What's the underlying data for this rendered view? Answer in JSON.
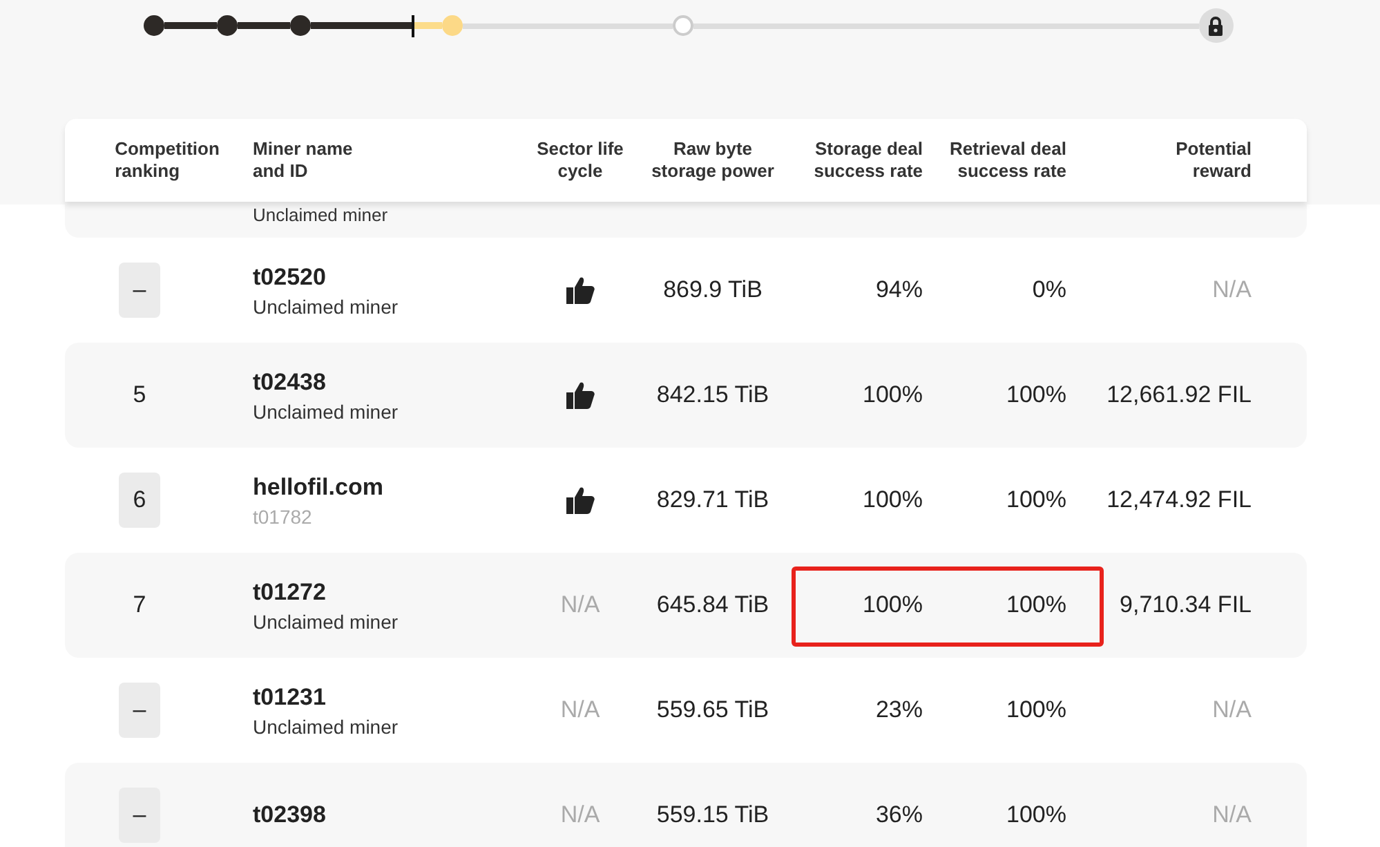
{
  "progress": {
    "steps": [
      {
        "kind": "done"
      },
      {
        "kind": "done"
      },
      {
        "kind": "done"
      },
      {
        "kind": "current"
      },
      {
        "kind": "upcoming"
      },
      {
        "kind": "locked"
      }
    ]
  },
  "table": {
    "columns": [
      "Competition ranking",
      "Miner name and ID",
      "Sector life cycle",
      "Raw byte storage power",
      "Storage deal success rate",
      "Retrieval deal success rate",
      "Potential reward"
    ],
    "cut_row": {
      "subtitle": "Unclaimed miner"
    },
    "rows": [
      {
        "rank": "–",
        "rank_badge": true,
        "name": "t02520",
        "subtitle": "Unclaimed miner",
        "subtitle_muted": false,
        "sector": {
          "kind": "thumb"
        },
        "power": "869.9 TiB",
        "storage_rate": "94%",
        "retrieval_rate": "0%",
        "reward": "N/A",
        "reward_muted": true,
        "highlighted": false
      },
      {
        "rank": "5",
        "rank_badge": false,
        "name": "t02438",
        "subtitle": "Unclaimed miner",
        "subtitle_muted": false,
        "sector": {
          "kind": "thumb"
        },
        "power": "842.15 TiB",
        "storage_rate": "100%",
        "retrieval_rate": "100%",
        "reward": "12,661.92 FIL",
        "reward_muted": false,
        "highlighted": false
      },
      {
        "rank": "6",
        "rank_badge": true,
        "name": "hellofil.com",
        "subtitle": "t01782",
        "subtitle_muted": true,
        "sector": {
          "kind": "thumb"
        },
        "power": "829.71 TiB",
        "storage_rate": "100%",
        "retrieval_rate": "100%",
        "reward": "12,474.92 FIL",
        "reward_muted": false,
        "highlighted": false
      },
      {
        "rank": "7",
        "rank_badge": false,
        "name": "t01272",
        "subtitle": "Unclaimed miner",
        "subtitle_muted": false,
        "sector": {
          "kind": "text",
          "text": "N/A"
        },
        "power": "645.84 TiB",
        "storage_rate": "100%",
        "retrieval_rate": "100%",
        "reward": "9,710.34 FIL",
        "reward_muted": false,
        "highlighted": true
      },
      {
        "rank": "–",
        "rank_badge": true,
        "name": "t01231",
        "subtitle": "Unclaimed miner",
        "subtitle_muted": false,
        "sector": {
          "kind": "text",
          "text": "N/A"
        },
        "power": "559.65 TiB",
        "storage_rate": "23%",
        "retrieval_rate": "100%",
        "reward": "N/A",
        "reward_muted": true,
        "highlighted": false
      },
      {
        "rank": "–",
        "rank_badge": true,
        "name": "t02398",
        "sector": {
          "kind": "text",
          "text": "N/A"
        },
        "power": "559.15 TiB",
        "storage_rate": "36%",
        "retrieval_rate": "100%",
        "reward": "N/A",
        "reward_muted": true,
        "highlighted": false
      }
    ]
  }
}
